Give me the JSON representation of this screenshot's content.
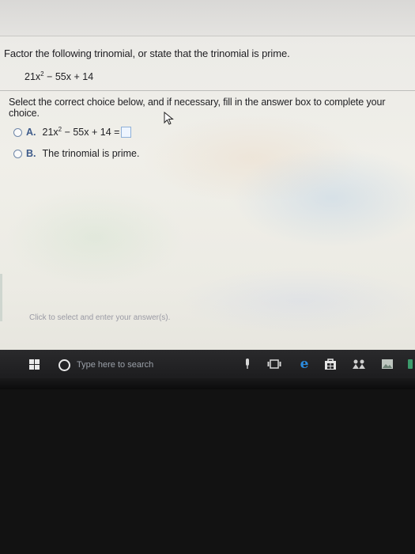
{
  "question": {
    "instruction": "Factor the following trinomial, or state that the trinomial is prime.",
    "expression_parts": {
      "coef": "21x",
      "exp": "2",
      "rest": " − 55x + 14"
    },
    "select_prompt": "Select the correct choice below, and if necessary, fill in the answer box to complete your choice."
  },
  "choices": [
    {
      "letter": "A.",
      "parts": {
        "coef": "21x",
        "exp": "2",
        "rest": " − 55x + 14 ="
      }
    },
    {
      "letter": "B.",
      "text": "The trinomial is prime."
    }
  ],
  "hint": "Click to select and enter your answer(s).",
  "taskbar": {
    "search_placeholder": "Type here to search",
    "icons": [
      "windows-start-icon",
      "search-icon",
      "microphone-icon",
      "task-view-icon",
      "edge-browser-icon",
      "store-icon",
      "people-icon",
      "photos-icon"
    ]
  },
  "colors": {
    "accent": "#3e5b8a",
    "answer_box_border": "#8fb0d8",
    "taskbar": "#1d1d1f",
    "edge_blue": "#2b8ce0"
  }
}
